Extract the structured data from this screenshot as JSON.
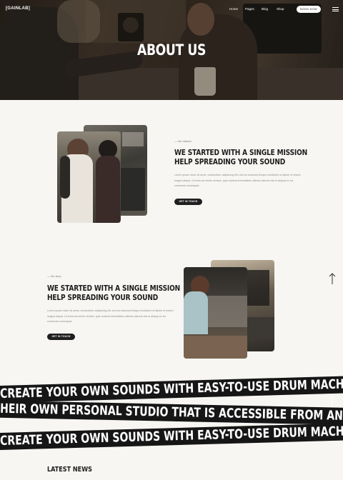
{
  "header": {
    "logo": "[GAINLAB]",
    "nav": [
      "Home",
      "Pages",
      "Blog",
      "Shop"
    ],
    "book_button": "BOOK NOW"
  },
  "hero": {
    "title": "ABOUT US"
  },
  "section_one": {
    "eyebrow": "— Our mission",
    "title_line1": "WE STARTED WITH A SINGLE MISSION",
    "title_line2": "HELP SPREADING YOUR SOUND",
    "body": "Lorem ipsum dolor sit amet, consectetur adipiscing elit, sed do eiusmod tempor incididunt ut labore et dolore magna aliqua. Ut enim ad minim veniam, quis nostrud exercitation ullamco laboris nisi ut aliquip ex ea commodo consequat.",
    "button": "GET IN TOUCH"
  },
  "section_two": {
    "eyebrow": "— Our story",
    "title_line1": "WE STARTED WITH A SINGLE MISSION",
    "title_line2": "HELP SPREADING YOUR SOUND",
    "body": "Lorem ipsum dolor sit amet, consectetur adipiscing elit, sed do eiusmod tempor incididunt ut labore et dolore magna aliqua. Ut enim ad minim veniam, quis nostrud exercitation ullamco laboris nisi ut aliquip ex ea commodo consequat.",
    "button": "GET IN TOUCH"
  },
  "banners": [
    "CREATE YOUR OWN SOUNDS WITH EASY-TO-USE DRUM MACHINES, SA",
    "HEIR OWN PERSONAL STUDIO THAT IS ACCESSIBLE FROM ANYWHER",
    "CREATE YOUR OWN SOUNDS WITH EASY-TO-USE DRUM MACHINES, SA"
  ],
  "news": {
    "title": "LATEST NEWS"
  },
  "icons": {
    "scroll_top": "arrow-up-icon",
    "menu": "hamburger-menu-icon"
  },
  "colors": {
    "dark": "#1f1f1f",
    "page_background": "#f7f6f3",
    "banner": "#161616"
  }
}
